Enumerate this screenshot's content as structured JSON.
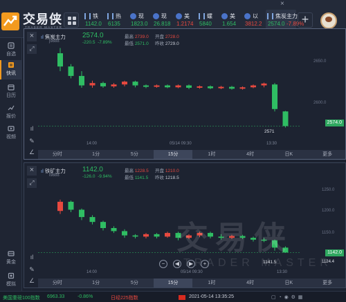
{
  "app": {
    "logo_text": "交易侠",
    "logo_subtitle": "TRADER MASTER"
  },
  "tickers": [
    {
      "name": "铁",
      "value": "1142.0",
      "trend": "down",
      "icon": "candle-icon"
    },
    {
      "name": "热",
      "value": "6135",
      "trend": "down",
      "icon": "candle-icon"
    },
    {
      "name": "现",
      "value": "1823.0",
      "trend": "down",
      "icon": "coin-icon"
    },
    {
      "name": "现",
      "value": "26.818",
      "trend": "down",
      "icon": "coin-icon"
    },
    {
      "name": "美",
      "value": "1.2174",
      "trend": "up",
      "icon": "coin-icon"
    },
    {
      "name": "螺",
      "value": "5840",
      "trend": "down",
      "icon": "candle-icon"
    },
    {
      "name": "美",
      "value": "1.654",
      "trend": "down",
      "icon": "coin-icon"
    },
    {
      "name": "以",
      "value": "3812.2",
      "trend": "up",
      "icon": "coin-icon"
    },
    {
      "name": "焦炭主力",
      "value": "2574.0",
      "extra": "-7.89%",
      "trend": "down",
      "icon": "candle-icon",
      "active": true
    }
  ],
  "topbar": {
    "close_label": "×",
    "add_label": "+"
  },
  "sidebar": {
    "items": [
      {
        "label": "自选",
        "icon": "star-icon"
      },
      {
        "label": "快讯",
        "icon": "news-icon",
        "active": true
      },
      {
        "label": "日历",
        "icon": "calendar-icon"
      },
      {
        "label": "报价",
        "icon": "chart-line-icon"
      },
      {
        "label": "视频",
        "icon": "video-icon"
      }
    ],
    "bottom_items": [
      {
        "label": "黄金",
        "icon": "gold-icon"
      },
      {
        "label": "模拟",
        "icon": "simulate-icon"
      }
    ]
  },
  "panel1": {
    "title": "焦炭主力",
    "code": "j9888",
    "price": "2574.0",
    "change": "-220.5",
    "change_pct": "-7.89%",
    "stats": {
      "high_label": "最高",
      "high": "2739.0",
      "open_label": "开盘",
      "open": "2728.0",
      "low_label": "最低",
      "low": "2571.0",
      "prev_label": "昨收",
      "prev": "2729.0"
    },
    "y_ticks": [
      "2650.0",
      "2600.0"
    ],
    "price_tag": "2574.0",
    "low_marker": "2571",
    "time_labels": [
      "14:00",
      "05/14 09:30",
      "13:30"
    ],
    "timeframes": [
      "分时",
      "1分",
      "5分",
      "15分",
      "1时",
      "4时",
      "日K",
      "更多"
    ],
    "selected_tf": "15分"
  },
  "panel2": {
    "title": "铁矿主力",
    "code": "i9888",
    "price": "1142.0",
    "change": "-126.0",
    "change_pct": "-9.94%",
    "stats": {
      "high_label": "最高",
      "high": "1228.5",
      "open_label": "开盘",
      "open": "1210.0",
      "low_label": "最低",
      "low": "1141.5",
      "prev_label": "昨收",
      "prev": "1218.5"
    },
    "y_ticks": [
      "1250.0",
      "1200.0",
      "1150.0",
      "1124.4"
    ],
    "price_tag": "1142.0",
    "low_marker": "1141.5",
    "time_labels": [
      "14:00",
      "05/14 09:30",
      "13:30"
    ],
    "timeframes": [
      "分时",
      "1分",
      "5分",
      "15分",
      "1时",
      "4时",
      "日K",
      "更多"
    ],
    "selected_tf": "15分"
  },
  "watermark": {
    "cn": "交易侠",
    "en": "TRADER MASTER"
  },
  "zoom_controls": [
    "−",
    "◀",
    "▶",
    "+"
  ],
  "statusbar": {
    "left": "美国重磅100指数",
    "left_value": "6963.33",
    "left_change": "-0.86%",
    "mid": "日经225指数",
    "datetime": "2021-05-14 13:35:25"
  },
  "colors": {
    "up": "#e8493f",
    "down": "#2fbd63",
    "accent": "#f29a1f"
  },
  "chart_data": [
    {
      "type": "candlestick",
      "title": "焦炭主力",
      "ylim": [
        2560,
        2750
      ],
      "series": [
        {
          "o": 2728,
          "c": 2700,
          "h": 2739,
          "l": 2690
        },
        {
          "o": 2700,
          "c": 2680,
          "h": 2705,
          "l": 2675
        },
        {
          "o": 2680,
          "c": 2660,
          "h": 2690,
          "l": 2655
        },
        {
          "o": 2660,
          "c": 2665,
          "h": 2670,
          "l": 2655
        },
        {
          "o": 2665,
          "c": 2658,
          "h": 2668,
          "l": 2655
        },
        {
          "o": 2658,
          "c": 2662,
          "h": 2665,
          "l": 2655
        },
        {
          "o": 2662,
          "c": 2668,
          "h": 2670,
          "l": 2658
        },
        {
          "o": 2668,
          "c": 2660,
          "h": 2670,
          "l": 2656
        },
        {
          "o": 2660,
          "c": 2657,
          "h": 2662,
          "l": 2654
        },
        {
          "o": 2657,
          "c": 2660,
          "h": 2662,
          "l": 2655
        },
        {
          "o": 2660,
          "c": 2656,
          "h": 2662,
          "l": 2654
        },
        {
          "o": 2656,
          "c": 2660,
          "h": 2662,
          "l": 2654
        },
        {
          "o": 2660,
          "c": 2655,
          "h": 2662,
          "l": 2652
        },
        {
          "o": 2655,
          "c": 2658,
          "h": 2660,
          "l": 2653
        },
        {
          "o": 2658,
          "c": 2654,
          "h": 2660,
          "l": 2652
        },
        {
          "o": 2654,
          "c": 2657,
          "h": 2659,
          "l": 2652
        },
        {
          "o": 2657,
          "c": 2653,
          "h": 2659,
          "l": 2651
        },
        {
          "o": 2653,
          "c": 2656,
          "h": 2658,
          "l": 2651
        },
        {
          "o": 2656,
          "c": 2660,
          "h": 2662,
          "l": 2654
        },
        {
          "o": 2660,
          "c": 2664,
          "h": 2666,
          "l": 2656
        },
        {
          "o": 2662,
          "c": 2610,
          "h": 2665,
          "l": 2605
        },
        {
          "o": 2605,
          "c": 2574,
          "h": 2606,
          "l": 2571
        }
      ]
    },
    {
      "type": "candlestick",
      "title": "铁矿主力",
      "ylim": [
        1130,
        1260
      ],
      "series": [
        {
          "o": 1210,
          "c": 1225,
          "h": 1228.5,
          "l": 1205
        },
        {
          "o": 1225,
          "c": 1212,
          "h": 1227,
          "l": 1208
        },
        {
          "o": 1212,
          "c": 1200,
          "h": 1214,
          "l": 1195
        },
        {
          "o": 1200,
          "c": 1192,
          "h": 1203,
          "l": 1188
        },
        {
          "o": 1192,
          "c": 1182,
          "h": 1194,
          "l": 1178
        },
        {
          "o": 1182,
          "c": 1177,
          "h": 1185,
          "l": 1174
        },
        {
          "o": 1177,
          "c": 1170,
          "h": 1180,
          "l": 1166
        },
        {
          "o": 1170,
          "c": 1168,
          "h": 1172,
          "l": 1165
        },
        {
          "o": 1168,
          "c": 1172,
          "h": 1174,
          "l": 1165
        },
        {
          "o": 1172,
          "c": 1168,
          "h": 1174,
          "l": 1165
        },
        {
          "o": 1168,
          "c": 1174,
          "h": 1176,
          "l": 1166
        },
        {
          "o": 1174,
          "c": 1166,
          "h": 1176,
          "l": 1162
        },
        {
          "o": 1166,
          "c": 1170,
          "h": 1172,
          "l": 1164
        },
        {
          "o": 1170,
          "c": 1174,
          "h": 1176,
          "l": 1167
        },
        {
          "o": 1174,
          "c": 1168,
          "h": 1176,
          "l": 1165
        },
        {
          "o": 1168,
          "c": 1166,
          "h": 1172,
          "l": 1163
        },
        {
          "o": 1166,
          "c": 1169,
          "h": 1171,
          "l": 1164
        },
        {
          "o": 1169,
          "c": 1166,
          "h": 1171,
          "l": 1164
        },
        {
          "o": 1166,
          "c": 1163,
          "h": 1168,
          "l": 1160
        },
        {
          "o": 1163,
          "c": 1162,
          "h": 1166,
          "l": 1159
        },
        {
          "o": 1162,
          "c": 1150,
          "h": 1163,
          "l": 1145
        },
        {
          "o": 1150,
          "c": 1142,
          "h": 1152,
          "l": 1141.5
        }
      ]
    }
  ]
}
